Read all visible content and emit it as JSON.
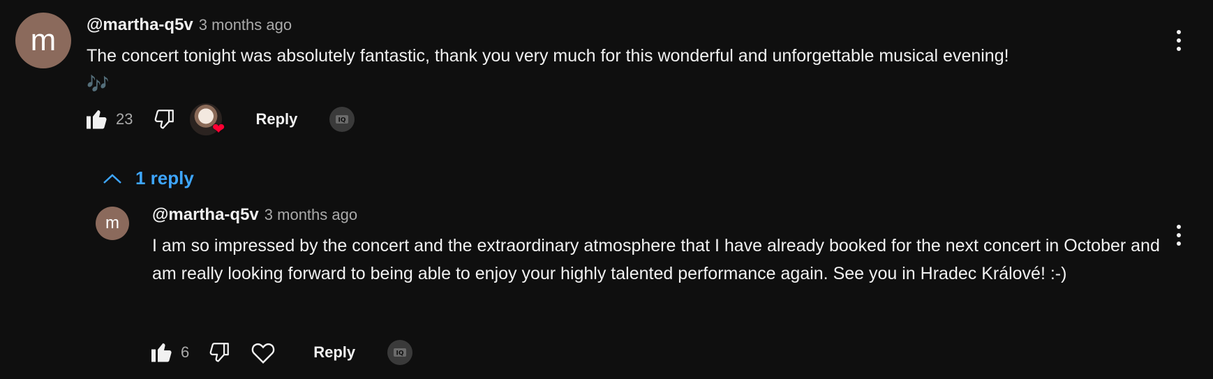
{
  "comment": {
    "avatar_letter": "m",
    "author": "@martha-q5v",
    "time": "3 months ago",
    "text": "The concert tonight was absolutely fantastic, thank you very much for this wonderful and unforgettable musical evening!",
    "emoji": "🎶",
    "like_count": "23",
    "reply_label": "Reply",
    "creator_heart": true
  },
  "replies_toggle": {
    "label": "1 reply",
    "icon": "chevron-up-icon"
  },
  "reply": {
    "avatar_letter": "m",
    "author": "@martha-q5v",
    "time": "3 months ago",
    "text": "I am so impressed by the concert and the extraordinary atmosphere that I have already booked for the next concert in October and am really looking forward to being able to enjoy your highly talented performance again. See you in Hradec Králové! :-)",
    "like_count": "6",
    "reply_label": "Reply"
  },
  "colors": {
    "background": "#0f0f0f",
    "accent": "#3ea6ff",
    "heart": "#ff0033",
    "avatar": "#8b6a5c"
  },
  "icons": {
    "like": "thumbs-up-icon",
    "dislike": "thumbs-down-icon",
    "heart": "heart-outline-icon",
    "menu": "more-vert-icon",
    "badge": "ai-badge-icon"
  }
}
